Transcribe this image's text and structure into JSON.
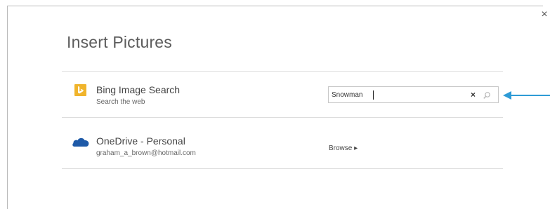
{
  "dialog": {
    "title": "Insert Pictures",
    "close_label": "×"
  },
  "bing": {
    "icon": "bing-logo-icon",
    "title": "Bing Image Search",
    "subtitle": "Search the web",
    "search": {
      "value": "Snowman",
      "clear_label": "×",
      "search_icon": "magnifier-icon"
    }
  },
  "onedrive": {
    "icon": "onedrive-cloud-icon",
    "title": "OneDrive - Personal",
    "subtitle": "graham_a_brown@hotmail.com",
    "browse_label": "Browse ▸"
  },
  "annotation": {
    "arrow_icon": "callout-arrow-icon",
    "arrow_color": "#2e9bd6"
  },
  "colors": {
    "bing_tile": "#f0b42c",
    "onedrive_blue": "#1e5aa8"
  }
}
